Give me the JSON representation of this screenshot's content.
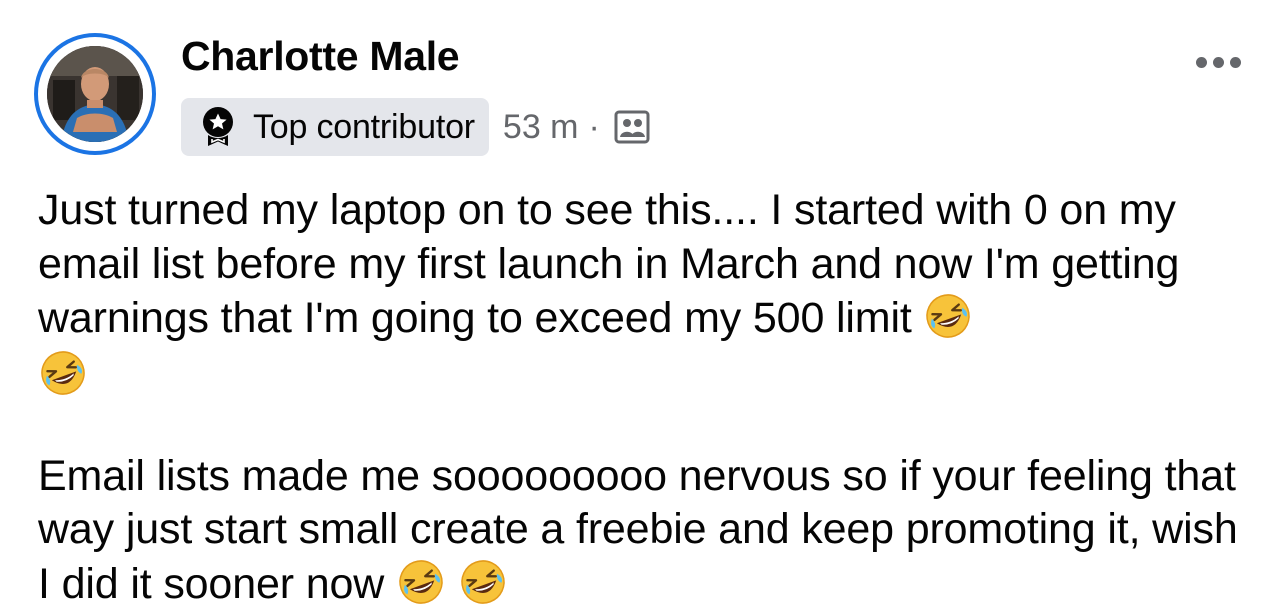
{
  "post": {
    "author": "Charlotte Male",
    "badge": {
      "label": "Top contributor",
      "icon": "top-contributor-badge-icon"
    },
    "timestamp": "53 m",
    "separator": "·",
    "privacy_icon": "group-members-icon",
    "menu_icon": "more-options-icon",
    "paragraphs": [
      {
        "text": "Just turned my laptop on to see this.... I started with 0 on my email list before my first launch in March and now I'm getting warnings that I'm going to exceed my 500 limit ",
        "emojis": [
          "🤣",
          "🤣"
        ]
      },
      {
        "text": "Email lists made me sooooooooo nervous so if your feeling that way just start small create a freebie and keep promoting it, wish I did it sooner now ",
        "emojis": [
          "🤣",
          "🤣"
        ]
      }
    ]
  },
  "colors": {
    "avatar_ring": "#1b74e4",
    "badge_bg": "#e4e6eb",
    "secondary_text": "#65676b",
    "primary_text": "#050505"
  }
}
